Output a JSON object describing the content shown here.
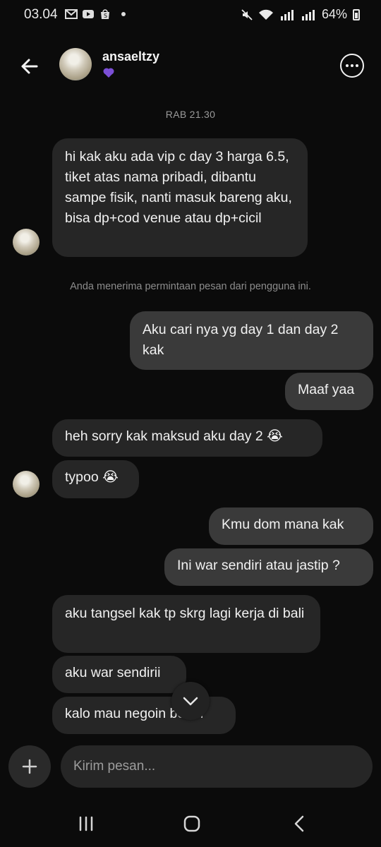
{
  "status_bar": {
    "time": "03.04",
    "battery": "64%",
    "sim1": "Vo) LTE1",
    "sim2": "Vo) LTE2"
  },
  "header": {
    "username": "ansaeltzy"
  },
  "timestamp": "RAB 21.30",
  "system_notice": "Anda menerima permintaan pesan dari pengguna ini.",
  "messages": [
    {
      "dir": "in",
      "text": "hi kak aku ada vip c day 3 harga 6.5, tiket atas nama pribadi, dibantu sampe fisik, nanti masuk bareng aku, bisa dp+cod venue atau dp+cicil"
    },
    {
      "dir": "out",
      "text": "Aku cari nya yg day 1 dan day 2 kak"
    },
    {
      "dir": "out",
      "text": "Maaf yaa"
    },
    {
      "dir": "in",
      "text": "heh sorry kak maksud aku day 2 😭"
    },
    {
      "dir": "in",
      "text": "typoo 😭"
    },
    {
      "dir": "out",
      "text": "Kmu dom mana kak"
    },
    {
      "dir": "out",
      "text": "Ini war sendiri atau jastip ?"
    },
    {
      "dir": "in",
      "text": "aku tangsel kak tp skrg lagi kerja di bali"
    },
    {
      "dir": "in",
      "text": "aku war sendirii"
    },
    {
      "dir": "in",
      "text": "kalo mau negoin boleh"
    }
  ],
  "composer": {
    "placeholder": "Kirim pesan..."
  },
  "icons": {
    "back": "arrow-left-icon",
    "more": "more-icon",
    "add": "plus-icon",
    "scroll": "chevron-down-icon",
    "nav_recents": "recents-icon",
    "nav_home": "home-icon",
    "nav_back": "nav-back-icon"
  },
  "colors": {
    "background": "#0b0b0b",
    "incoming_bubble": "#262626",
    "outgoing_bubble": "#3a3a3a",
    "badge": "#7b4fd6"
  }
}
